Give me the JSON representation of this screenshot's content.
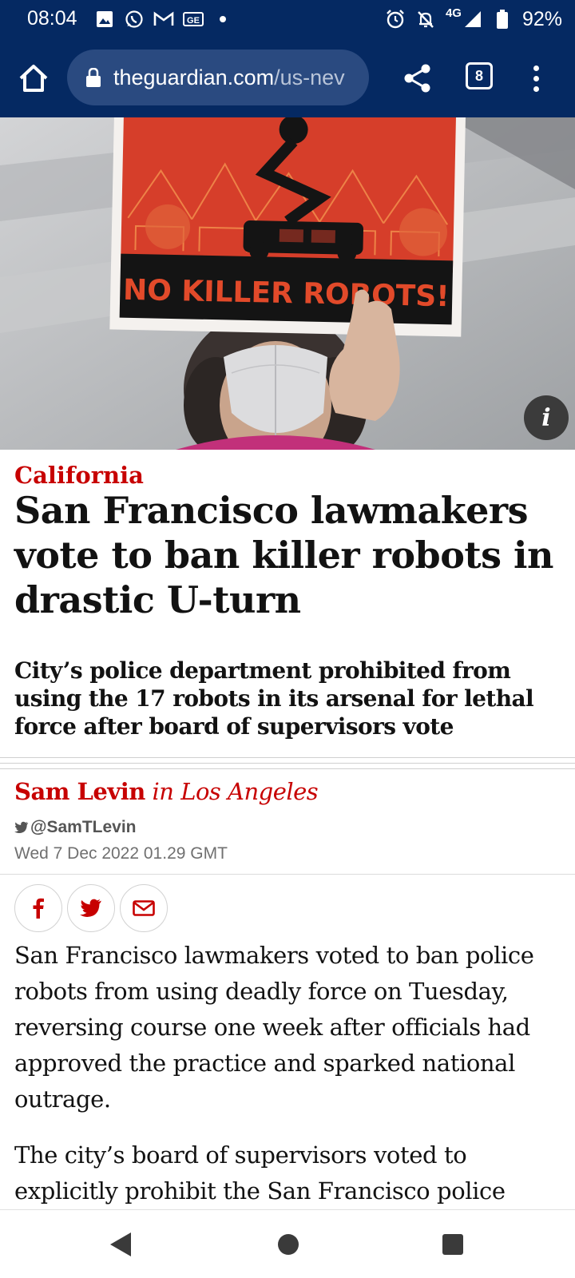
{
  "status_bar": {
    "time": "08:04",
    "icons_left": [
      "image-icon",
      "whatsapp-icon",
      "gmail-icon",
      "ge-icon",
      "dot-icon"
    ],
    "network": "4G",
    "battery": "92%"
  },
  "browser": {
    "url_domain": "theguardian.com",
    "url_path": "/us-nev",
    "tab_count": "8"
  },
  "hero_image": {
    "sign_text": "NO KILLER ROBOTS!"
  },
  "article": {
    "section": "California",
    "headline": "San Francisco lawmakers vote to ban killer robots in drastic U-turn",
    "standfirst": "City’s police department prohibited from using the 17 robots in its arsenal for lethal force after board of supervisors vote",
    "byline_name": "Sam Levin",
    "byline_location": "in Los Angeles",
    "twitter_handle": "@SamTLevin",
    "date": "Wed 7 Dec 2022 01.29 GMT",
    "share_icons": [
      "facebook-icon",
      "twitter-icon",
      "email-icon"
    ],
    "paragraphs": [
      "San Francisco lawmakers voted to ban police robots from using deadly force on Tuesday, reversing course one week after officials had approved the practice and sparked national outrage.",
      "The city’s board of supervisors voted to explicitly prohibit the San Francisco police"
    ]
  },
  "colors": {
    "status_bar_bg": "#052962",
    "section_red": "#c70000",
    "headline_text": "#121212"
  }
}
